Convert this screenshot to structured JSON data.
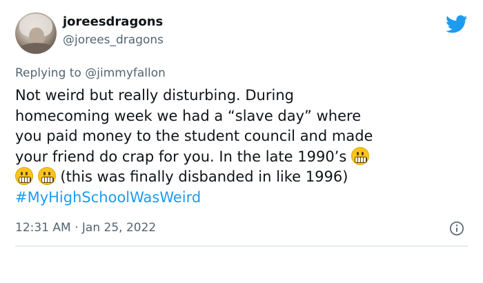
{
  "tweet": {
    "author": {
      "display_name": "joreesdragons",
      "handle": "@jorees_dragons"
    },
    "replying_to_prefix": "Replying to",
    "replying_to_user": "@jimmyfallon",
    "body_lines": [
      "Not weird but really disturbing. During",
      "homecoming week we had a “slave day” where",
      "you paid money to the student council and made",
      "your friend do crap for you. In the late 1990’s",
      "(this was finally disbanded in like 1996)"
    ],
    "hashtag": "#MyHighSchoolWasWeird",
    "timestamp": "12:31 AM · Jan 25, 2022"
  },
  "icons": {
    "brand": "twitter-bird-icon",
    "info": "info-icon",
    "emoji": "grimacing-face-emoji"
  },
  "colors": {
    "brand": "#1d9bf0",
    "text": "#0f1419",
    "muted": "#536471",
    "divider": "#cfd9de"
  }
}
